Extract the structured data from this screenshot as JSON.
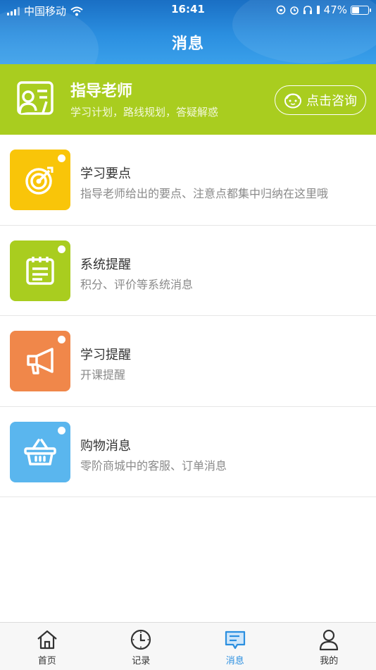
{
  "status_bar": {
    "carrier": "中国移动",
    "time": "16:41",
    "battery": "47%",
    "battery_level": 0.47
  },
  "header": {
    "title": "消息"
  },
  "mentor": {
    "name": "指导老师",
    "description": "学习计划，路线规划，答疑解惑",
    "consult_label": "点击咨询"
  },
  "messages": [
    {
      "title": "学习要点",
      "subtitle": "指导老师给出的要点、注意点都集中归纳在这里哦",
      "color": "#f9c509",
      "icon": "target-icon"
    },
    {
      "title": "系统提醒",
      "subtitle": "积分、评价等系统消息",
      "color": "#a9cd1f",
      "icon": "notepad-icon"
    },
    {
      "title": "学习提醒",
      "subtitle": "开课提醒",
      "color": "#f0874a",
      "icon": "megaphone-icon"
    },
    {
      "title": "购物消息",
      "subtitle": "零阶商城中的客服、订单消息",
      "color": "#5ab6ee",
      "icon": "basket-icon"
    }
  ],
  "tabbar": {
    "active_color": "#2b8fe0",
    "tabs": [
      {
        "label": "首页",
        "icon": "home-icon"
      },
      {
        "label": "记录",
        "icon": "clock-icon"
      },
      {
        "label": "消息",
        "icon": "message-icon",
        "active": true
      },
      {
        "label": "我的",
        "icon": "person-icon"
      }
    ]
  }
}
